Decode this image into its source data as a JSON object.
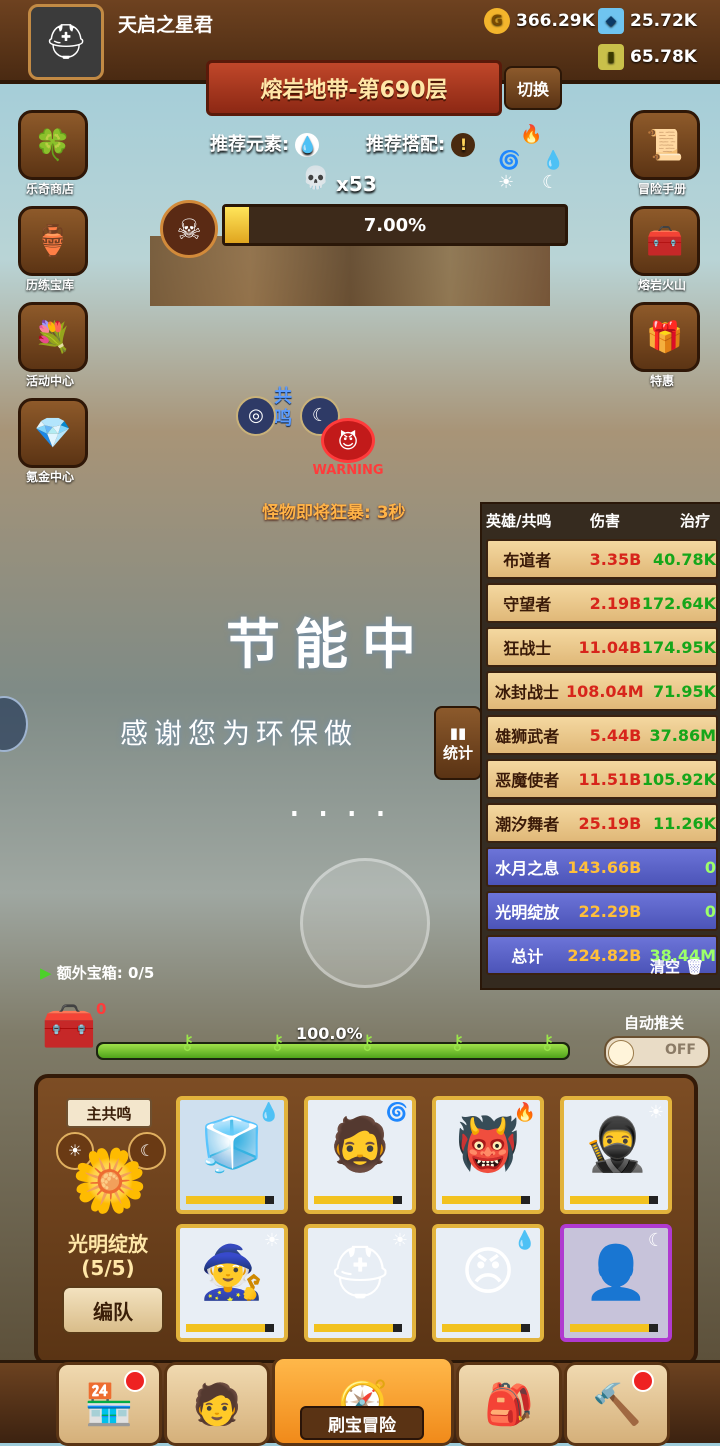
{
  "player": {
    "name": "天启之星君"
  },
  "resources": [
    {
      "icon": "gold-coin-icon",
      "value": "366.29K"
    },
    {
      "icon": "diamond-icon",
      "value": "25.72K"
    },
    {
      "icon": "potion-icon",
      "value": "65.78K"
    }
  ],
  "stage": {
    "title": "熔岩地带-第690层",
    "switch_label": "切换"
  },
  "left_menu": [
    "乐奇商店",
    "历练宝库",
    "活动中心",
    "氪金中心"
  ],
  "right_menu": [
    "冒险手册",
    "熔岩火山",
    "特惠"
  ],
  "recommend": {
    "element_label": "推荐元素:",
    "combo_label": "推荐搭配:"
  },
  "boss": {
    "kills": "x53",
    "progress_text": "7.00%",
    "progress": 0.07
  },
  "resonance_marker": "共鸣",
  "warning": {
    "label": "WARNING",
    "text": "怪物即将狂暴: 3秒"
  },
  "power_save": {
    "title": "节能中",
    "subtitle": "感谢您为环保做",
    "dots": "...."
  },
  "stats_button": "统计",
  "stats": {
    "headers": [
      "英雄/共鸣",
      "伤害",
      "治疗"
    ],
    "rows": [
      {
        "name": "布道者",
        "damage": "3.35B",
        "heal": "40.78K",
        "kind": "hero"
      },
      {
        "name": "守望者",
        "damage": "2.19B",
        "heal": "172.64K",
        "kind": "hero"
      },
      {
        "name": "狂战士",
        "damage": "11.04B",
        "heal": "174.95K",
        "kind": "hero"
      },
      {
        "name": "冰封战士",
        "damage": "108.04M",
        "heal": "71.95K",
        "kind": "hero"
      },
      {
        "name": "雄狮武者",
        "damage": "5.44B",
        "heal": "37.86M",
        "kind": "hero"
      },
      {
        "name": "恶魔使者",
        "damage": "11.51B",
        "heal": "105.92K",
        "kind": "hero"
      },
      {
        "name": "潮汐舞者",
        "damage": "25.19B",
        "heal": "11.26K",
        "kind": "hero"
      },
      {
        "name": "水月之息",
        "damage": "143.66B",
        "heal": "0",
        "kind": "res"
      },
      {
        "name": "光明绽放",
        "damage": "22.29B",
        "heal": "0",
        "kind": "res"
      },
      {
        "name": "总计",
        "damage": "224.82B",
        "heal": "38.44M",
        "kind": "res"
      }
    ],
    "clear_label": "清空"
  },
  "chest": {
    "label": "额外宝箱: 0/5",
    "count": "0"
  },
  "wave": {
    "percent_text": "100.0%",
    "progress": 1.0
  },
  "auto_push": {
    "label": "自动推关",
    "state": "OFF"
  },
  "team": {
    "main_resonance_label": "主共鸣",
    "resonance_name": "光明绽放",
    "resonance_count": "(5/5)",
    "formation_label": "编队",
    "heroes": [
      {
        "icon": "ice-warrior-icon",
        "element": "water-icon"
      },
      {
        "icon": "scarred-man-icon",
        "element": "wind-icon"
      },
      {
        "icon": "red-demon-icon",
        "element": "fire-icon"
      },
      {
        "icon": "green-hood-icon",
        "element": "light-icon"
      },
      {
        "icon": "dark-hood-icon",
        "element": "light-icon"
      },
      {
        "icon": "spartan-icon",
        "element": "light-icon"
      },
      {
        "icon": "blue-hair-icon",
        "element": "water-icon"
      },
      {
        "icon": "shadow-hood-icon",
        "element": "moon-icon"
      }
    ]
  },
  "nav": {
    "active_label": "刷宝冒险"
  }
}
